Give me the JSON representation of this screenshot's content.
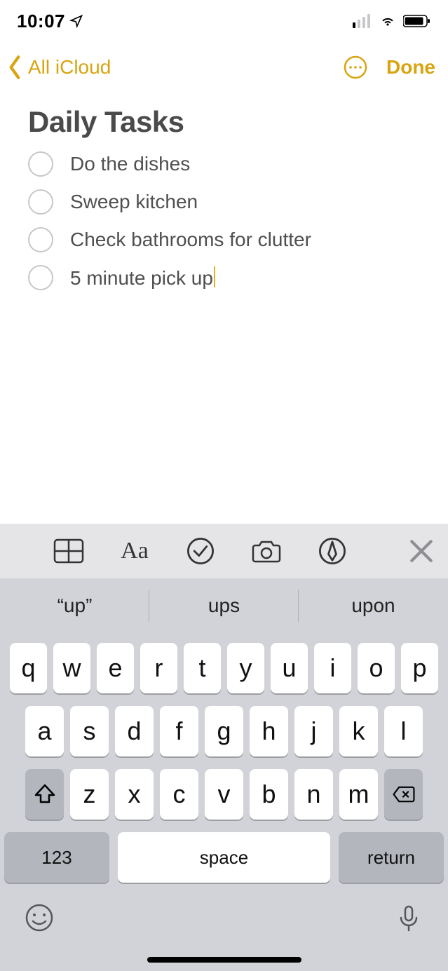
{
  "status_bar": {
    "time": "10:07"
  },
  "nav": {
    "back_label": "All iCloud",
    "done_label": "Done"
  },
  "note": {
    "title": "Daily Tasks",
    "items": [
      "Do the dishes",
      "Sweep kitchen",
      "Check bathrooms for clutter",
      "5 minute pick up"
    ]
  },
  "keyboard": {
    "suggestions": [
      "“up”",
      "ups",
      "upon"
    ],
    "row1": [
      "q",
      "w",
      "e",
      "r",
      "t",
      "y",
      "u",
      "i",
      "o",
      "p"
    ],
    "row2": [
      "a",
      "s",
      "d",
      "f",
      "g",
      "h",
      "j",
      "k",
      "l"
    ],
    "row3": [
      "z",
      "x",
      "c",
      "v",
      "b",
      "n",
      "m"
    ],
    "numeric_label": "123",
    "space_label": "space",
    "return_label": "return"
  }
}
